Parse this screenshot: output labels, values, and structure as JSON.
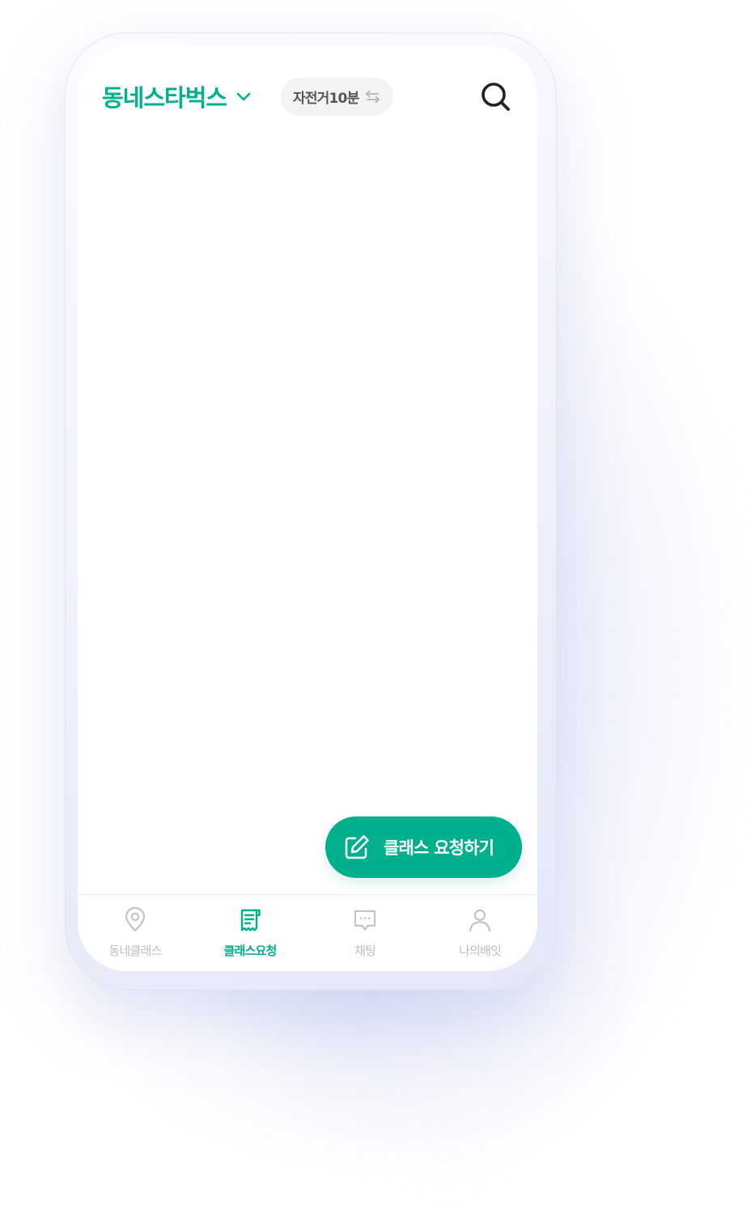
{
  "header": {
    "location_name": "동네스타벅스",
    "distance_chip": "자전거10분"
  },
  "fab": {
    "label": "클래스 요청하기"
  },
  "tabs": [
    {
      "label": "동네클래스",
      "icon": "location-pin-icon",
      "active": false
    },
    {
      "label": "클래스요청",
      "icon": "request-document-icon",
      "active": true
    },
    {
      "label": "채팅",
      "icon": "chat-bubble-icon",
      "active": false
    },
    {
      "label": "나의배잇",
      "icon": "person-icon",
      "active": false
    }
  ],
  "colors": {
    "accent": "#00b08d",
    "chip_background": "#f3f3f5",
    "inactive_tab": "#bdbdbd",
    "icon_dark": "#222222"
  }
}
